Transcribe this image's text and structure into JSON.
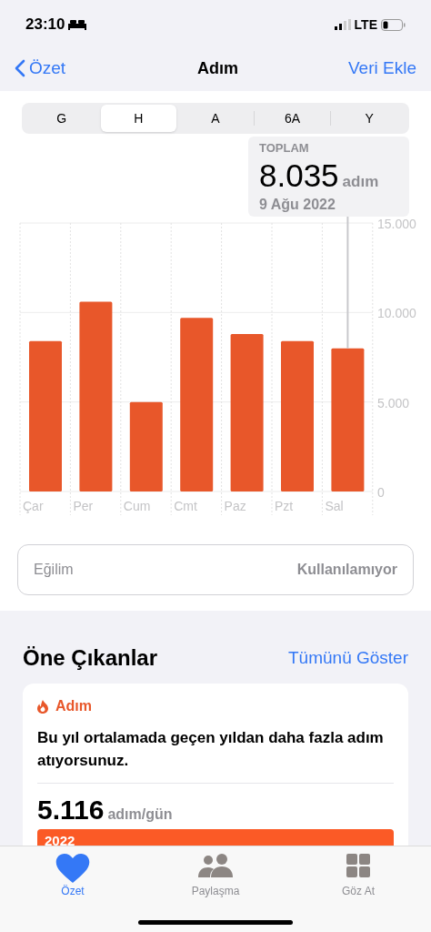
{
  "status_bar": {
    "time": "23:10",
    "network": "LTE"
  },
  "nav": {
    "back": "Özet",
    "title": "Adım",
    "action": "Veri Ekle"
  },
  "segments": [
    {
      "label": "G",
      "selected": false
    },
    {
      "label": "H",
      "selected": true
    },
    {
      "label": "A",
      "selected": false
    },
    {
      "label": "6A",
      "selected": false
    },
    {
      "label": "Y",
      "selected": false
    }
  ],
  "summary": {
    "label": "TOPLAM",
    "value": "8.035",
    "unit": "adım",
    "date": "9 Ağu 2022"
  },
  "chart_data": {
    "type": "bar",
    "categories": [
      "Çar",
      "Per",
      "Cum",
      "Cmt",
      "Paz",
      "Pzt",
      "Sal"
    ],
    "series": [
      {
        "color": "#e8572a",
        "values": [
          8400,
          10600,
          5000,
          9700,
          8800,
          8400,
          8000
        ]
      }
    ],
    "ylim": [
      0,
      15000
    ],
    "yticks": [
      {
        "value": 0,
        "label": "0"
      },
      {
        "value": 5000,
        "label": "5.000"
      },
      {
        "value": 10000,
        "label": "10.000"
      },
      {
        "value": 15000,
        "label": "15.000"
      }
    ]
  },
  "trend": {
    "label": "Eğilim",
    "value": "Kullanılamıyor"
  },
  "highlights": {
    "title": "Öne Çıkanlar",
    "link": "Tümünü Göster",
    "card": {
      "category": "Adım",
      "text": "Bu yıl ortalamada geçen yıldan daha fazla adım atıyorsunuz.",
      "value": "5.116",
      "unit": "adım/gün",
      "bar_label": "2022"
    }
  },
  "tab_bar": [
    {
      "label": "Özet",
      "selected": true
    },
    {
      "label": "Paylaşma",
      "selected": false
    },
    {
      "label": "Göz At",
      "selected": false
    }
  ]
}
